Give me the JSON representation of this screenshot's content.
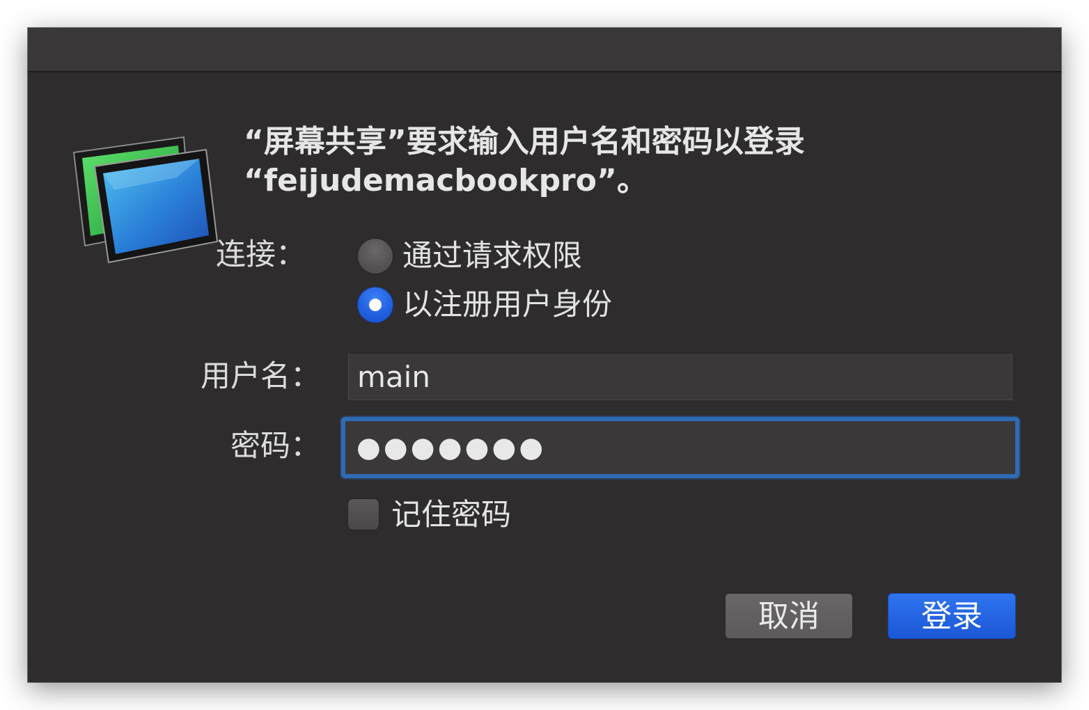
{
  "dialog": {
    "message_line1": "“屏幕共享”要求输入用户名和密码以登录",
    "message_line2": "“feijudemacbookpro”。",
    "connect_label": "连接：",
    "options": [
      {
        "label": "通过请求权限",
        "selected": false
      },
      {
        "label": "以注册用户身份",
        "selected": true
      }
    ],
    "username_label": "用户名：",
    "username_value": "main",
    "password_label": "密码：",
    "password_value": "●●●●●●●",
    "remember_label": "记住密码",
    "remember_checked": false,
    "cancel_label": "取消",
    "login_label": "登录"
  },
  "colors": {
    "window_bg": "#2f2c2d",
    "accent": "#1f5fe0",
    "focus_ring": "#2f6bb5"
  },
  "icon": "screen-sharing-app-icon"
}
